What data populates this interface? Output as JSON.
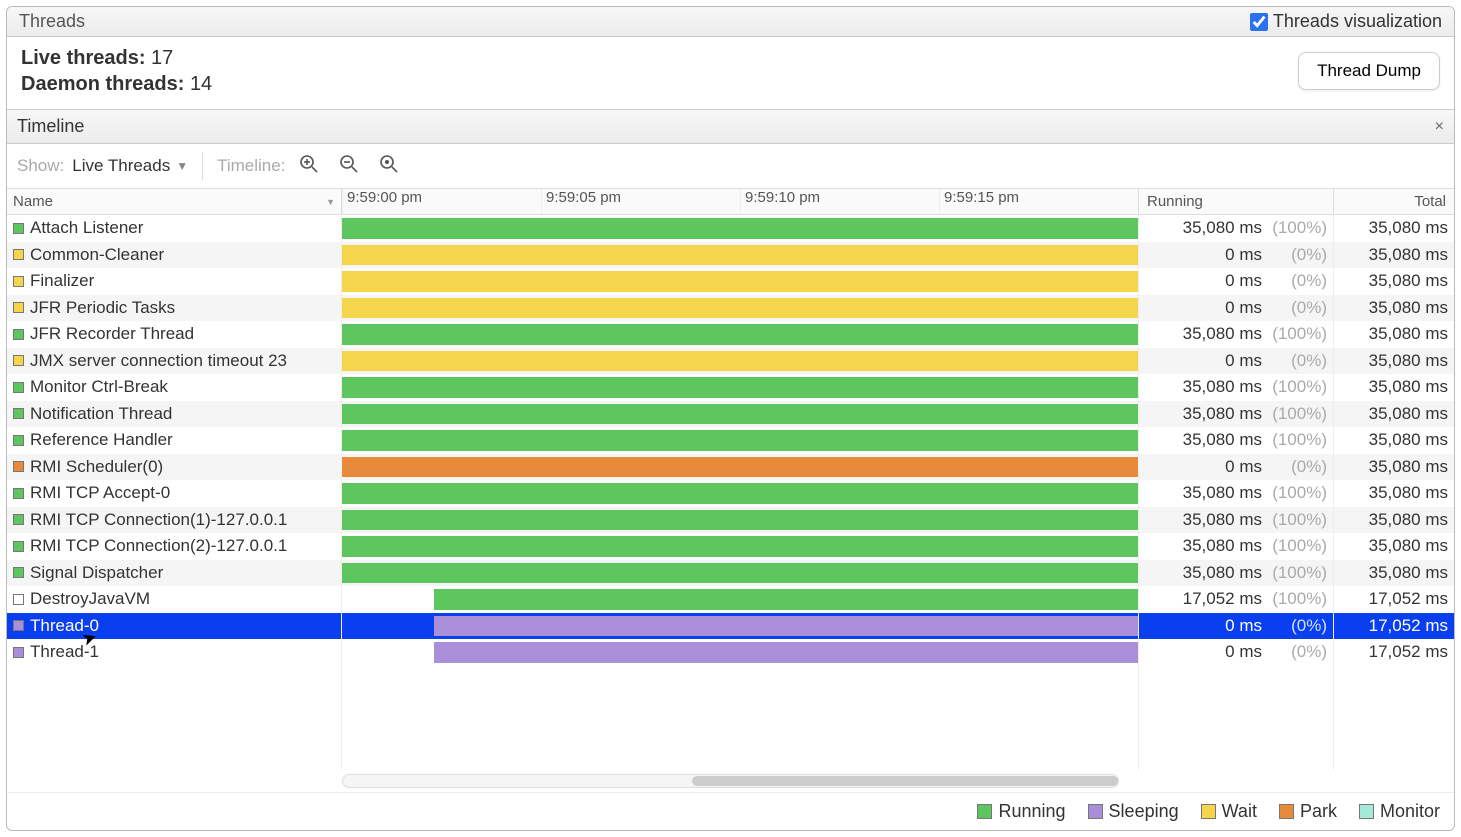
{
  "header": {
    "title": "Threads",
    "checkbox_label": "Threads visualization",
    "checked": true
  },
  "stats": {
    "live_label": "Live threads:",
    "live_count": "17",
    "daemon_label": "Daemon threads:",
    "daemon_count": "14"
  },
  "dump_button": "Thread Dump",
  "timeline": {
    "title": "Timeline",
    "close": "×",
    "show_label": "Show:",
    "show_value": "Live Threads",
    "tl_label": "Timeline:",
    "columns": {
      "name": "Name",
      "running": "Running",
      "total": "Total"
    },
    "ticks": [
      "9:59:00 pm",
      "9:59:05 pm",
      "9:59:10 pm",
      "9:59:15 pm"
    ],
    "scroll": {
      "left_pct": 45,
      "width_pct": 55
    }
  },
  "colors": {
    "running": "#5ec65e",
    "sleeping": "#a98ed9",
    "wait": "#f5d54b",
    "park": "#e98a3a",
    "monitor": "#a5e9d9",
    "selected": "#0a3ff0"
  },
  "legend": [
    {
      "label": "Running",
      "color": "running"
    },
    {
      "label": "Sleeping",
      "color": "sleeping"
    },
    {
      "label": "Wait",
      "color": "wait"
    },
    {
      "label": "Park",
      "color": "park"
    },
    {
      "label": "Monitor",
      "color": "monitor"
    }
  ],
  "threads": [
    {
      "name": "Attach Listener",
      "state": "running",
      "start": 0,
      "len": 100,
      "running": "35,080 ms",
      "pct": "(100%)",
      "total": "35,080 ms"
    },
    {
      "name": "Common-Cleaner",
      "state": "wait",
      "start": 0,
      "len": 100,
      "running": "0 ms",
      "pct": "(0%)",
      "total": "35,080 ms"
    },
    {
      "name": "Finalizer",
      "state": "wait",
      "start": 0,
      "len": 100,
      "running": "0 ms",
      "pct": "(0%)",
      "total": "35,080 ms"
    },
    {
      "name": "JFR Periodic Tasks",
      "state": "wait",
      "start": 0,
      "len": 100,
      "running": "0 ms",
      "pct": "(0%)",
      "total": "35,080 ms"
    },
    {
      "name": "JFR Recorder Thread",
      "state": "running",
      "start": 0,
      "len": 100,
      "running": "35,080 ms",
      "pct": "(100%)",
      "total": "35,080 ms"
    },
    {
      "name": "JMX server connection timeout 23",
      "state": "wait",
      "start": 0,
      "len": 100,
      "running": "0 ms",
      "pct": "(0%)",
      "total": "35,080 ms"
    },
    {
      "name": "Monitor Ctrl-Break",
      "state": "running",
      "start": 0,
      "len": 100,
      "running": "35,080 ms",
      "pct": "(100%)",
      "total": "35,080 ms"
    },
    {
      "name": "Notification Thread",
      "state": "running",
      "start": 0,
      "len": 100,
      "running": "35,080 ms",
      "pct": "(100%)",
      "total": "35,080 ms"
    },
    {
      "name": "Reference Handler",
      "state": "running",
      "start": 0,
      "len": 100,
      "running": "35,080 ms",
      "pct": "(100%)",
      "total": "35,080 ms"
    },
    {
      "name": "RMI Scheduler(0)",
      "state": "park",
      "start": 0,
      "len": 100,
      "running": "0 ms",
      "pct": "(0%)",
      "total": "35,080 ms"
    },
    {
      "name": "RMI TCP Accept-0",
      "state": "running",
      "start": 0,
      "len": 100,
      "running": "35,080 ms",
      "pct": "(100%)",
      "total": "35,080 ms"
    },
    {
      "name": "RMI TCP Connection(1)-127.0.0.1",
      "state": "running",
      "start": 0,
      "len": 100,
      "running": "35,080 ms",
      "pct": "(100%)",
      "total": "35,080 ms"
    },
    {
      "name": "RMI TCP Connection(2)-127.0.0.1",
      "state": "running",
      "start": 0,
      "len": 100,
      "running": "35,080 ms",
      "pct": "(100%)",
      "total": "35,080 ms"
    },
    {
      "name": "Signal Dispatcher",
      "state": "running",
      "start": 0,
      "len": 100,
      "running": "35,080 ms",
      "pct": "(100%)",
      "total": "35,080 ms"
    },
    {
      "name": "DestroyJavaVM",
      "state": "running",
      "start": 11.5,
      "len": 88.5,
      "running": "17,052 ms",
      "pct": "(100%)",
      "total": "17,052 ms",
      "swatch_override": "#ffffff"
    },
    {
      "name": "Thread-0",
      "state": "sleeping",
      "start": 11.5,
      "len": 88.5,
      "running": "0 ms",
      "pct": "(0%)",
      "total": "17,052 ms",
      "selected": true
    },
    {
      "name": "Thread-1",
      "state": "sleeping",
      "start": 11.5,
      "len": 88.5,
      "running": "0 ms",
      "pct": "(0%)",
      "total": "17,052 ms"
    }
  ]
}
